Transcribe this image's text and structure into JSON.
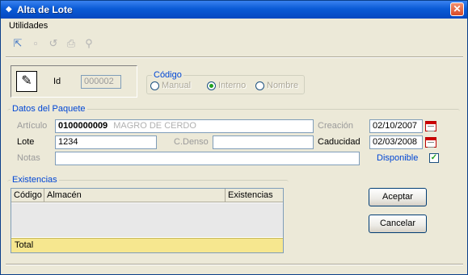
{
  "window": {
    "title": "Alta de Lote",
    "close_glyph": "✕"
  },
  "menu": {
    "utilidades": "Utilidades"
  },
  "toolbar": {
    "icons": [
      "exit-icon",
      "save-icon",
      "undo-icon",
      "print-icon",
      "search-icon"
    ]
  },
  "header": {
    "id_label": "Id",
    "id_value": "000002",
    "codigo_legend": "Código",
    "radio_manual": "Manual",
    "radio_interno": "Interno",
    "radio_nombre": "Nombre",
    "selected_radio": "Interno"
  },
  "paquete": {
    "legend": "Datos del Paquete",
    "articulo_label": "Artículo",
    "articulo_code": "0100000009",
    "articulo_name": "MAGRO DE CERDO",
    "creacion_label": "Creación",
    "creacion_value": "02/10/2007",
    "lote_label": "Lote",
    "lote_value": "1234",
    "cdenso_label": "C.Denso",
    "cdenso_value": "",
    "caducidad_label": "Caducidad",
    "caducidad_value": "02/03/2008",
    "notas_label": "Notas",
    "notas_value": "",
    "disponible_label": "Disponible",
    "disponible_checked": true
  },
  "existencias": {
    "legend": "Existencias",
    "columns": [
      "Código",
      "Almacén",
      "Existencias"
    ],
    "rows": [],
    "total_label": "Total"
  },
  "buttons": {
    "aceptar": "Aceptar",
    "cancelar": "Cancelar"
  },
  "colors": {
    "titlebar": "#0a5bd6",
    "legend": "#0046d5",
    "total_row": "#f6e78f"
  }
}
